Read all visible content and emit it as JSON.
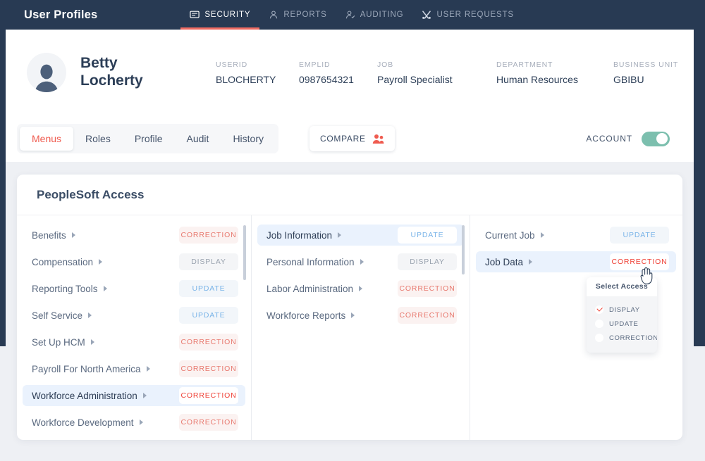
{
  "app": {
    "title": "User Profiles"
  },
  "nav": [
    {
      "label": "SECURITY",
      "icon": "monitor-icon",
      "active": true
    },
    {
      "label": "REPORTS",
      "icon": "person-icon",
      "active": false
    },
    {
      "label": "AUDITING",
      "icon": "person-check-icon",
      "active": false
    },
    {
      "label": "USER REQUESTS",
      "icon": "tools-icon",
      "active": false
    }
  ],
  "profile": {
    "avatar_icon": "user-avatar-icon",
    "first_name": "Betty",
    "last_name": "Locherty",
    "fields": [
      {
        "label": "USERID",
        "value": "BLOCHERTY"
      },
      {
        "label": "EMPLID",
        "value": "0987654321"
      },
      {
        "label": "JOB",
        "value": "Payroll Specialist"
      },
      {
        "label": "DEPARTMENT",
        "value": "Human Resources"
      },
      {
        "label": "BUSINESS UNIT",
        "value": "GBIBU"
      }
    ]
  },
  "tabs": [
    {
      "label": "Menus",
      "active": true
    },
    {
      "label": "Roles",
      "active": false
    },
    {
      "label": "Profile",
      "active": false
    },
    {
      "label": "Audit",
      "active": false
    },
    {
      "label": "History",
      "active": false
    }
  ],
  "compare": {
    "label": "COMPARE",
    "icon": "people-icon"
  },
  "account": {
    "label": "ACCOUNT",
    "toggle_on": true
  },
  "panel": {
    "title": "PeopleSoft Access",
    "columns": [
      {
        "items": [
          {
            "label": "Benefits",
            "access": "CORRECTION",
            "selected": false
          },
          {
            "label": "Compensation",
            "access": "DISPLAY",
            "selected": false
          },
          {
            "label": "Reporting Tools",
            "access": "UPDATE",
            "selected": false
          },
          {
            "label": "Self Service",
            "access": "UPDATE",
            "selected": false
          },
          {
            "label": "Set Up HCM",
            "access": "CORRECTION",
            "selected": false
          },
          {
            "label": "Payroll For North America",
            "access": "CORRECTION",
            "selected": false
          },
          {
            "label": "Workforce Administration",
            "access": "CORRECTION",
            "selected": true
          },
          {
            "label": "Workforce Development",
            "access": "CORRECTION",
            "selected": false
          }
        ]
      },
      {
        "items": [
          {
            "label": "Job Information",
            "access": "UPDATE",
            "selected": true
          },
          {
            "label": "Personal Information",
            "access": "DISPLAY",
            "selected": false
          },
          {
            "label": "Labor Administration",
            "access": "CORRECTION",
            "selected": false
          },
          {
            "label": "Workforce Reports",
            "access": "CORRECTION",
            "selected": false
          }
        ]
      },
      {
        "items": [
          {
            "label": "Current Job",
            "access": "UPDATE",
            "selected": false
          },
          {
            "label": "Job Data",
            "access": "CORRECTION",
            "selected": true
          }
        ]
      }
    ]
  },
  "dropdown": {
    "title": "Select Access",
    "options": [
      {
        "label": "DISPLAY",
        "checked": true
      },
      {
        "label": "UPDATE",
        "checked": false
      },
      {
        "label": "CORRECTION",
        "checked": false
      }
    ]
  },
  "colors": {
    "header_bg": "#283a53",
    "accent_red": "#ef5b4f",
    "accent_blue": "#7ab4e8",
    "accent_gray": "#9aa3af",
    "toggle_green": "#7cbfae",
    "selected_row": "#eaf2fd"
  }
}
